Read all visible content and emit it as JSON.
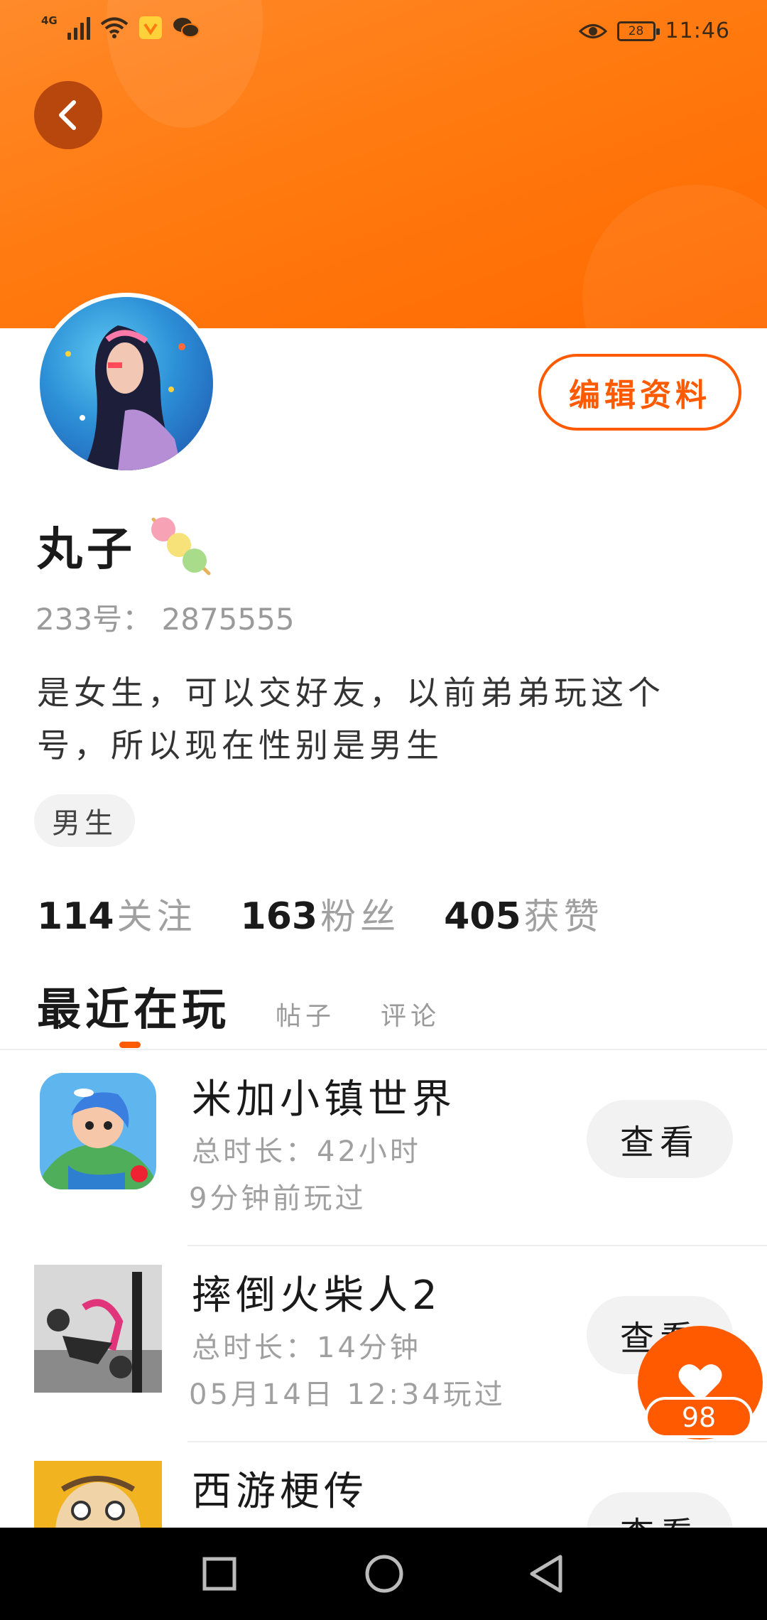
{
  "status_bar": {
    "network": "4G",
    "battery": "28",
    "time": "11:46",
    "icons": [
      "signal-icon",
      "wifi-icon",
      "vpn-shield-icon",
      "wechat-icon",
      "eye-comfort-icon",
      "battery-icon"
    ]
  },
  "profile": {
    "nickname": "丸子",
    "uid": "233号： 2875555",
    "bio": "是女生，可以交好友，以前弟弟玩这个号，所以现在性别是男生",
    "gender_tag": "男生",
    "edit_label": "编辑资料"
  },
  "stats": [
    {
      "num": "114",
      "label": "关注"
    },
    {
      "num": "163",
      "label": "粉丝"
    },
    {
      "num": "405",
      "label": "获赞"
    }
  ],
  "tabs": {
    "active": "最近在玩",
    "posts": "帖子",
    "comments": "评论"
  },
  "games": [
    {
      "title": "米加小镇世界",
      "duration": "总时长：42小时",
      "last_played": "9分钟前玩过",
      "button": "查看"
    },
    {
      "title": "摔倒火柴人2",
      "duration": "总时长：14分钟",
      "last_played": "05月14日 12:34玩过",
      "button": "查看"
    },
    {
      "title": "西游梗传",
      "duration": "",
      "last_played": "",
      "button": "查看"
    }
  ],
  "like": {
    "count": "98"
  },
  "colors": {
    "accent": "#ff5a00",
    "banner": "#ff7a10"
  }
}
